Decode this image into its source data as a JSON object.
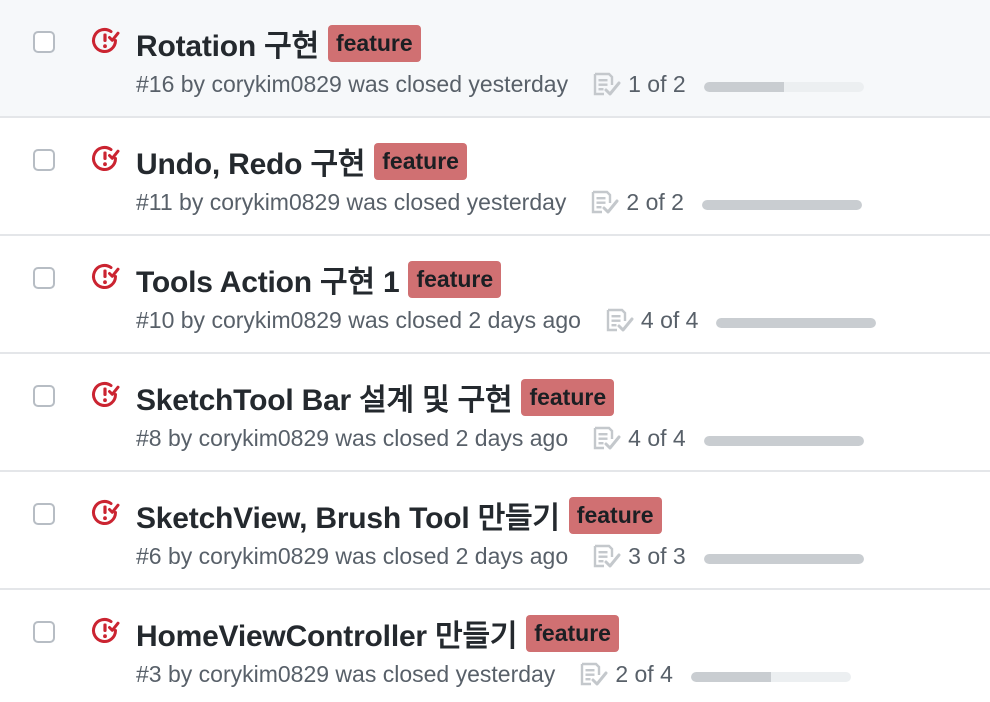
{
  "colors": {
    "closed_icon": "#cb2431",
    "label_bg": "#d07072",
    "progress_fill": "#c9cdd1",
    "progress_track": "#eceff1"
  },
  "issues": [
    {
      "title": "Rotation 구현",
      "label": "feature",
      "meta": "#16 by corykim0829 was closed yesterday",
      "progress_text": "1 of 2",
      "done": 1,
      "total": 2,
      "hover": true
    },
    {
      "title": "Undo, Redo 구현",
      "label": "feature",
      "meta": "#11 by corykim0829 was closed yesterday",
      "progress_text": "2 of 2",
      "done": 2,
      "total": 2
    },
    {
      "title": "Tools Action 구현 1",
      "label": "feature",
      "meta": "#10 by corykim0829 was closed 2 days ago",
      "progress_text": "4 of 4",
      "done": 4,
      "total": 4
    },
    {
      "title": "SketchTool Bar 설계 및 구현",
      "label": "feature",
      "meta": "#8 by corykim0829 was closed 2 days ago",
      "progress_text": "4 of 4",
      "done": 4,
      "total": 4
    },
    {
      "title": "SketchView, Brush Tool 만들기",
      "label": "feature",
      "meta": "#6 by corykim0829 was closed 2 days ago",
      "progress_text": "3 of 3",
      "done": 3,
      "total": 3
    },
    {
      "title": "HomeViewController 만들기",
      "label": "feature",
      "meta": "#3 by corykim0829 was closed yesterday",
      "progress_text": "2 of 4",
      "done": 2,
      "total": 4
    }
  ]
}
